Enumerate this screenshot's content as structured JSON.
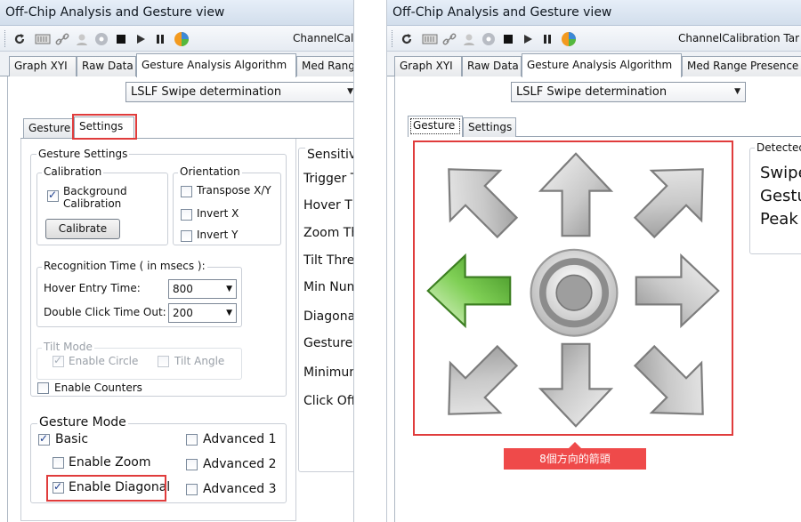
{
  "window": {
    "title": "Off-Chip Analysis and Gesture view"
  },
  "toolbar": {
    "channel_label_left": "ChannelCal",
    "channel_label_right": "ChannelCalibration Tar"
  },
  "tabs": [
    {
      "label": "Graph XYI"
    },
    {
      "label": "Raw Data"
    },
    {
      "label": "Gesture Analysis Algorithm"
    },
    {
      "label": "Med Rang"
    },
    {
      "label": "Med Range Presence"
    }
  ],
  "algorithm_select": {
    "value": "LSLF Swipe determination"
  },
  "subtabs": {
    "gesture": "Gesture",
    "settings": "Settings"
  },
  "settings": {
    "gesture_settings_title": "Gesture Settings",
    "calibration_title": "Calibration",
    "background_calibration_line1": "Background",
    "background_calibration_line2": "Calibration",
    "calibrate_button": "Calibrate",
    "orientation_title": "Orientation",
    "transpose": "Transpose X/Y",
    "invert_x": "Invert X",
    "invert_y": "Invert Y",
    "recognition_title": "Recognition Time ( in msecs ):",
    "hover_entry_label": "Hover Entry Time:",
    "hover_entry_value": "800",
    "double_click_label": "Double Click Time Out:",
    "double_click_value": "200",
    "tilt_title": "Tilt Mode",
    "enable_circle": "Enable Circle",
    "tilt_angle": "Tilt Angle",
    "enable_counters": "Enable Counters",
    "gesture_mode_title": "Gesture Mode",
    "basic": "Basic",
    "enable_zoom": "Enable Zoom",
    "enable_diagonal": "Enable Diagonal",
    "advanced1": "Advanced 1",
    "advanced2": "Advanced 2",
    "advanced3": "Advanced 3"
  },
  "sensitivity": {
    "title": "Sensitiv",
    "items": [
      "Trigger T",
      "Hover Th",
      "Zoom Th",
      "Tilt Thre",
      "Min Num",
      "Diagona",
      "Gesture",
      "Minimum",
      "Click Off"
    ]
  },
  "detected": {
    "title": "Detected",
    "lines": [
      "Swipe",
      "Gestu",
      "Peak"
    ]
  },
  "annotation": {
    "label": "8個方向的箭頭"
  },
  "colors": {
    "highlight_red": "#e03c3c",
    "callout_red": "#ef4a4a",
    "active_arrow": "#6cc04a"
  }
}
